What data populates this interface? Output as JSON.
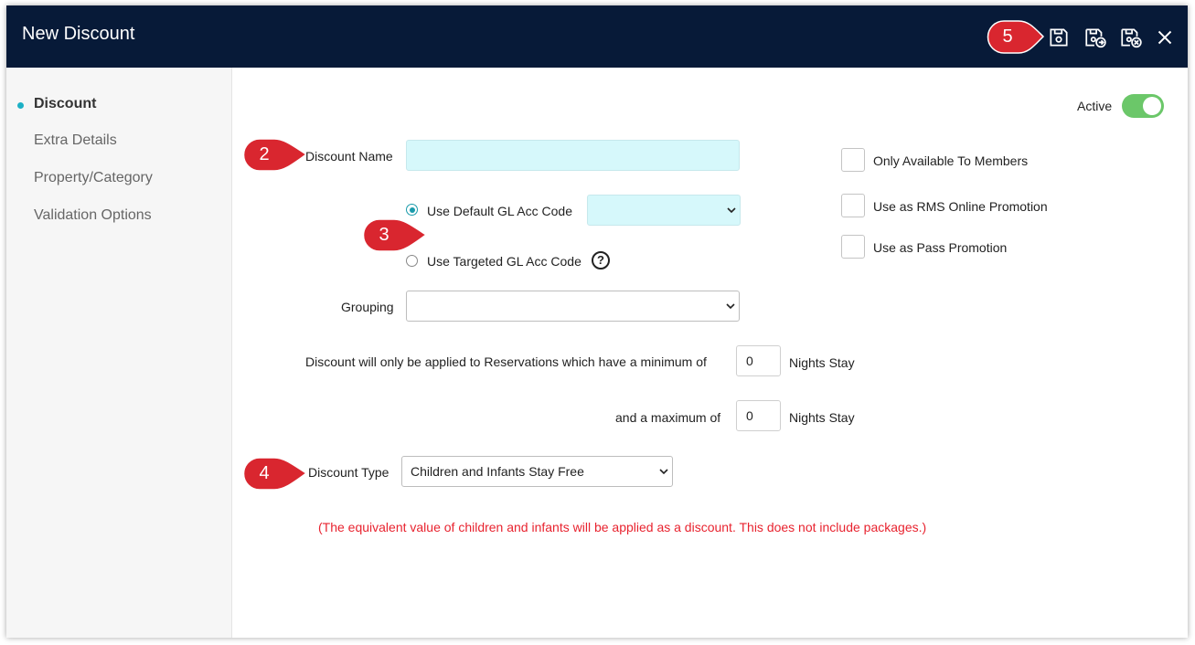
{
  "window": {
    "title": "New Discount"
  },
  "toolbar": {
    "icons": [
      "save-icon",
      "save-and-new-icon",
      "save-and-close-icon",
      "close-icon"
    ]
  },
  "sidebar": {
    "items": [
      {
        "label": "Discount",
        "active": true
      },
      {
        "label": "Extra Details",
        "active": false
      },
      {
        "label": "Property/Category",
        "active": false
      },
      {
        "label": "Validation Options",
        "active": false
      }
    ]
  },
  "form": {
    "active_label": "Active",
    "active_on": true,
    "discount_name_label": "Discount Name",
    "discount_name_value": "",
    "gl_default_label": "Use Default GL Acc Code",
    "gl_default_selected": true,
    "gl_default_value": "",
    "gl_targeted_label": "Use Targeted GL Acc Code",
    "help_symbol": "?",
    "grouping_label": "Grouping",
    "grouping_value": "",
    "min_label": "Discount will only be applied to Reservations which have a minimum of",
    "min_value": "0",
    "nights_label": "Nights Stay",
    "max_label": "and a maximum of",
    "max_value": "0",
    "discount_type_label": "Discount Type",
    "discount_type_value": "Children and Infants Stay Free",
    "note": "(The equivalent value of children and infants will be applied as a discount. This does not include packages.)",
    "checkboxes": [
      {
        "label": "Only Available To Members",
        "checked": false
      },
      {
        "label": "Use as RMS Online Promotion",
        "checked": false
      },
      {
        "label": "Use as Pass Promotion",
        "checked": false
      }
    ]
  },
  "callouts": [
    "2",
    "3",
    "4",
    "5"
  ],
  "colors": {
    "header": "#071a38",
    "accent": "#1cb0c5",
    "toggle": "#6bc769",
    "callout": "#d9262f",
    "note": "#e8232f",
    "field_highlight": "#d6f8fb"
  }
}
